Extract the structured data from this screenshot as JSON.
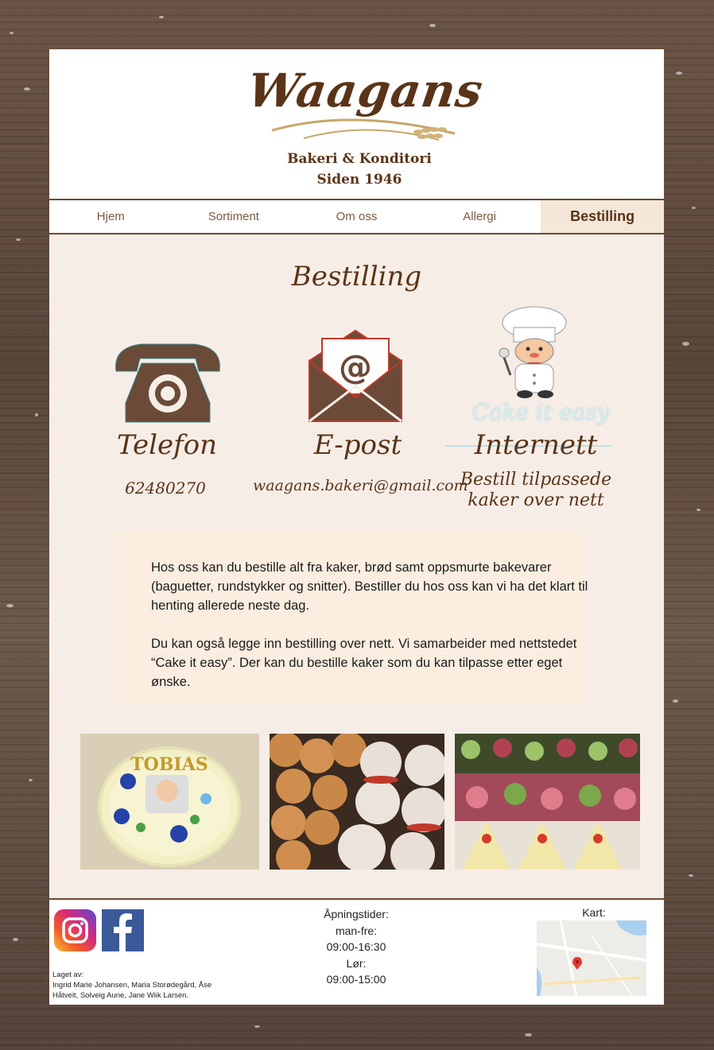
{
  "logo": {
    "name": "Waagans",
    "line1": "Bakeri & Konditori",
    "line2": "Siden 1946"
  },
  "nav": {
    "items": [
      {
        "label": "Hjem",
        "active": false
      },
      {
        "label": "Sortiment",
        "active": false
      },
      {
        "label": "Om oss",
        "active": false
      },
      {
        "label": "Allergi",
        "active": false
      },
      {
        "label": "Bestilling",
        "active": true
      }
    ]
  },
  "main": {
    "title": "Bestilling",
    "contacts": [
      {
        "icon": "telephone-icon",
        "label": "Telefon",
        "value": "62480270"
      },
      {
        "icon": "envelope-icon",
        "label": "E-post",
        "value": "waagans.bakeri@gmail.com"
      },
      {
        "icon": "chef-icon",
        "label": "Internett",
        "value_line1": "Bestill tilpassede",
        "value_line2": "kaker over nett",
        "brand": "Cake it easy"
      }
    ],
    "info": {
      "p1": "Hos  oss kan du bestille alt fra  kaker, brød samt oppsmurte bakevarer (baguetter,  rundstykker og snitter).  Bestiller du hos oss kan vi ha det klart til henting allerede neste dag.",
      "p2": "Du kan også legge inn bestilling over nett. Vi samarbeider med nettstedet “Cake it easy”. Der kan du bestille kaker som du kan tilpasse etter eget ønske."
    },
    "photos": [
      {
        "name": "cake-photo",
        "cake_text": "TOBIAS"
      },
      {
        "name": "buns-photo"
      },
      {
        "name": "sandwich-photo"
      }
    ]
  },
  "footer": {
    "social": [
      "instagram-icon",
      "facebook-icon"
    ],
    "made_by_label": "Laget av:",
    "made_by_names": "Ingrid Marie Johansen, Maria Storødegård, Åse Håtveit, Solveig Aune, Jane Wiik Larsen.",
    "hours_title": "Åpningstider:",
    "weekday_label": "man-fre:",
    "weekday_hours": "09:00-16:30",
    "saturday_label": "Lør:",
    "saturday_hours": "09:00-15:00",
    "map_label": "Kart:"
  },
  "colors": {
    "brand_brown": "#5a3418",
    "nav_border": "#6b4a33",
    "active_tab_bg": "#f4e6d9",
    "content_bg": "#f7ede7",
    "info_bg": "#fbeee0"
  }
}
